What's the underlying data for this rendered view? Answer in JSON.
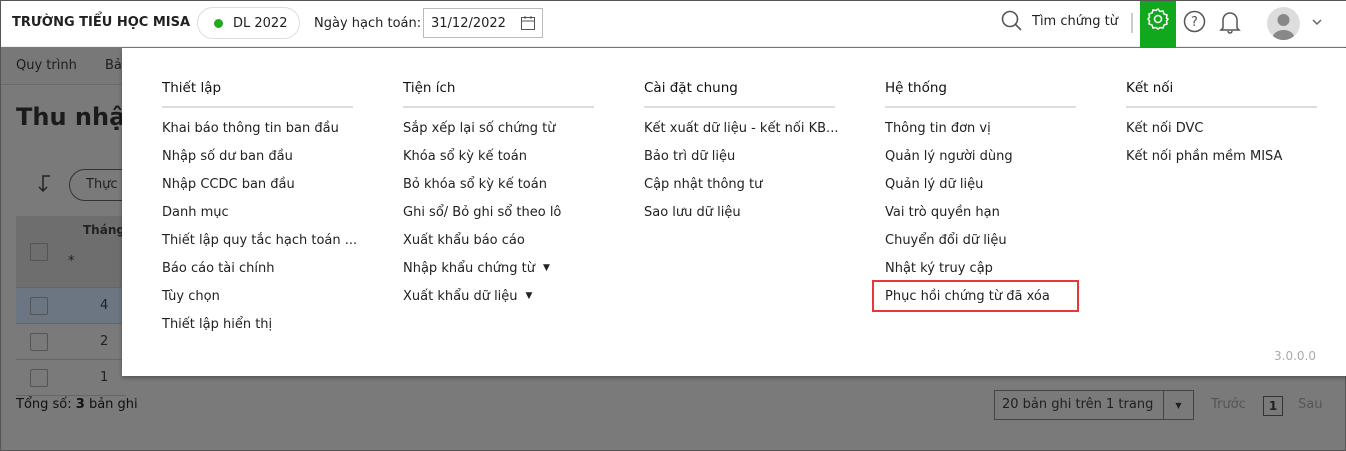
{
  "header": {
    "brand": "TRƯỜNG TIỂU HỌC MISA",
    "dataset": "DL 2022",
    "date_label": "Ngày hạch toán:",
    "date_value": "31/12/2022",
    "search_label": "Tìm chứng từ"
  },
  "background": {
    "nav_items": [
      "Quy trình",
      "Bả"
    ],
    "page_title": "Thu nhập",
    "filter_chip": "Thực",
    "column_header": "Tháng",
    "filter_star": "*",
    "rows": [
      "4",
      "2",
      "1"
    ],
    "total_prefix": "Tổng số:",
    "total_count": "3",
    "total_suffix": "bản ghi",
    "page_size": "20 bản ghi trên 1 trang",
    "prev": "Trước",
    "page": "1",
    "next": "Sau"
  },
  "menu": {
    "version": "3.0.0.0",
    "columns": [
      {
        "title": "Thiết lập",
        "items": [
          "Khai báo thông tin ban đầu",
          "Nhập số dư ban đầu",
          "Nhập CCDC ban đầu",
          "Danh mục",
          "Thiết lập quy tắc hạch toán ...",
          "Báo cáo tài chính",
          "Tùy chọn",
          "Thiết lập hiển thị"
        ]
      },
      {
        "title": "Tiện ích",
        "items": [
          "Sắp xếp lại số chứng từ",
          "Khóa sổ kỳ kế toán",
          "Bỏ khóa sổ kỳ kế toán",
          "Ghi sổ/ Bỏ ghi sổ theo lô",
          "Xuất khẩu báo cáo",
          "Nhập khẩu chứng từ",
          "Xuất khẩu dữ liệu"
        ]
      },
      {
        "title": "Cài đặt chung",
        "items": [
          "Kết xuất dữ liệu - kết nối KB...",
          "Bảo trì dữ liệu",
          "Cập nhật thông tư",
          "Sao lưu dữ liệu"
        ]
      },
      {
        "title": "Hệ thống",
        "items": [
          "Thông tin đơn vị",
          "Quản lý người dùng",
          "Quản lý dữ liệu",
          "Vai trò quyền hạn",
          "Chuyển đổi dữ liệu",
          "Nhật ký truy cập",
          "Phục hồi chứng từ đã xóa"
        ]
      },
      {
        "title": "Kết nối",
        "items": [
          "Kết nối DVC",
          "Kết nối phần mềm MISA"
        ]
      }
    ]
  }
}
